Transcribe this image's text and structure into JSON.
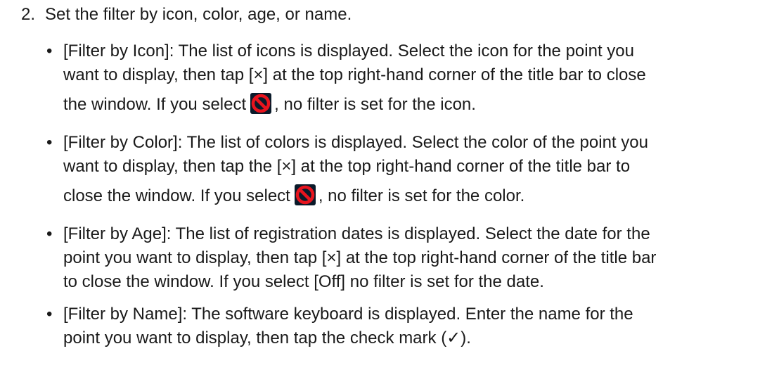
{
  "step": {
    "number": "2.",
    "text": "Set the filter by icon, color, age, or name."
  },
  "bullet_glyph": "•",
  "icon": {
    "name": "no-entry-icon",
    "fill": "#e8141e",
    "bg": "#0a1a2a"
  },
  "bullets": [
    {
      "line1": "[Filter by Icon]: The list of icons is displayed. Select the icon for the point you",
      "line2": "want to display, then tap [×] at the top right-hand corner of the title bar to close",
      "line3a": "the window. If you select",
      "line3b": ", no filter is set for the icon."
    },
    {
      "line1": "[Filter by Color]: The list of colors is displayed. Select the color of the point you",
      "line2": "want to display, then tap the [×] at the top right-hand corner of the title bar to",
      "line3a": "close the window. If you select",
      "line3b": ", no filter is set for the color."
    },
    {
      "line1": "[Filter by Age]: The list of registration dates is displayed. Select the date for the",
      "line2": "point you want to display, then tap [×] at the top right-hand corner of the title bar",
      "line3": "to close the window. If you select [Off] no filter is set for the date."
    },
    {
      "line1": "[Filter by Name]: The software keyboard is displayed. Enter the name for the",
      "line2": "point you want to display, then tap the check mark (✓)."
    }
  ]
}
